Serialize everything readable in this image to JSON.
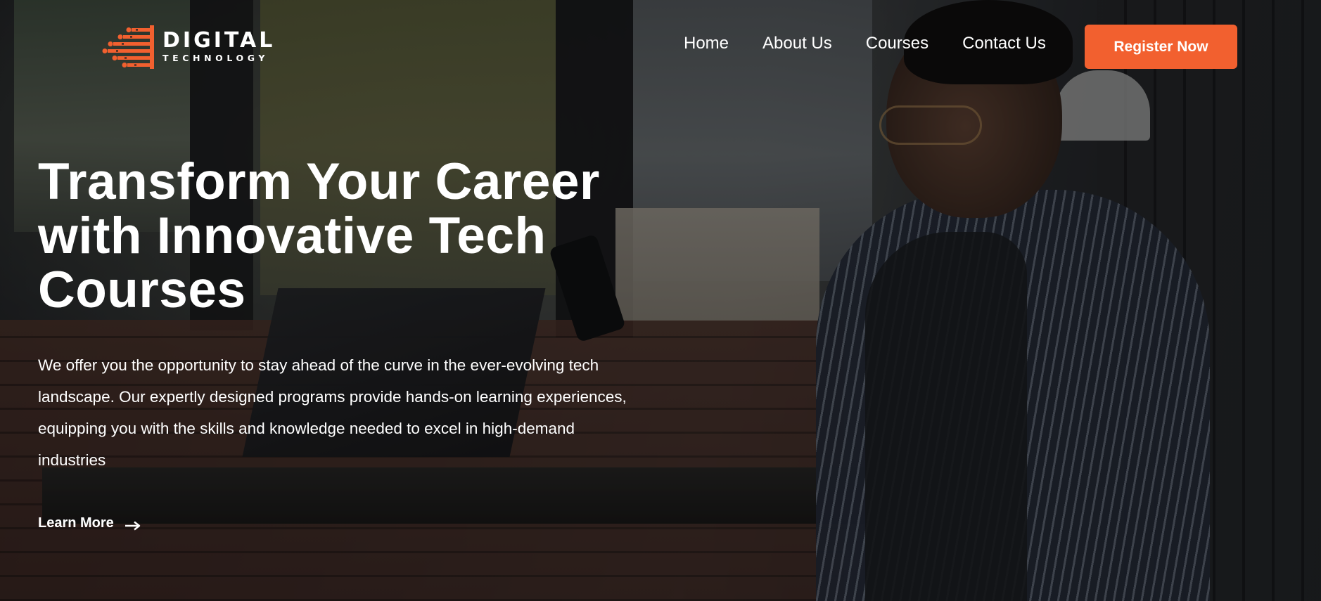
{
  "brand": {
    "name": "DIGITAL",
    "tagline": "TECHNOLOGY",
    "accent_color": "#f2602f",
    "icon": "circuit-logo-icon"
  },
  "nav": {
    "items": [
      {
        "label": "Home"
      },
      {
        "label": "About Us"
      },
      {
        "label": "Courses"
      },
      {
        "label": "Contact Us"
      }
    ],
    "cta_label": "Register Now"
  },
  "hero": {
    "title_line1": "Transform Your Career",
    "title_line2": "with Innovative Tech",
    "title_line3": "Courses",
    "description_line1": "We offer you the opportunity to stay ahead of the curve in the ever-evolving tech",
    "description_line2": "landscape. Our expertly designed programs provide hands-on learning experiences,",
    "description_line3": "equipping you with the skills and knowledge needed to excel in high-demand",
    "description_line4": "industries",
    "learn_more_label": "Learn More",
    "learn_more_icon": "arrow-right-icon"
  }
}
